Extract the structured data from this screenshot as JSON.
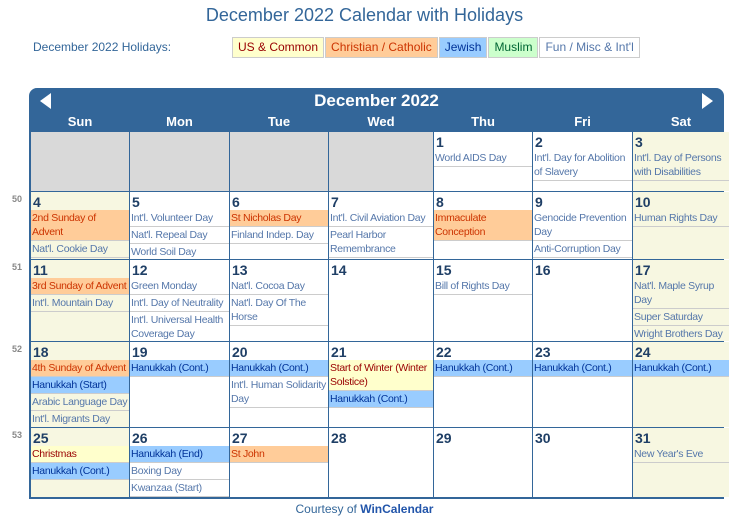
{
  "title": "December 2022 Calendar with Holidays",
  "legend_label": "December 2022 Holidays:",
  "legend": [
    {
      "label": "US & Common",
      "type": "us"
    },
    {
      "label": "Christian / Catholic",
      "type": "chr"
    },
    {
      "label": "Jewish",
      "type": "jew"
    },
    {
      "label": "Muslim",
      "type": "mus"
    },
    {
      "label": "Fun / Misc & Int'l",
      "type": "fun"
    }
  ],
  "colors": {
    "header": "#336699",
    "us": "#ffffcc",
    "christian": "#ffcc99",
    "jewish": "#99ccff",
    "muslim": "#ccffcc",
    "weekend": "#f7f7e1",
    "empty": "#d9d9d9"
  },
  "month": "December 2022",
  "nav": {
    "prev": "left-arrow-icon",
    "next": "right-arrow-icon"
  },
  "weekdays": [
    "Sun",
    "Mon",
    "Tue",
    "Wed",
    "Thu",
    "Fri",
    "Sat"
  ],
  "weeks": [
    {
      "num": "",
      "days": [
        null,
        null,
        null,
        null,
        {
          "d": "1",
          "ev": [
            {
              "t": "World AIDS Day",
              "c": "fun"
            }
          ]
        },
        {
          "d": "2",
          "ev": [
            {
              "t": "Int'l. Day for Abolition of Slavery",
              "c": "fun"
            }
          ]
        },
        {
          "d": "3",
          "ev": [
            {
              "t": "Int'l. Day of Persons with Disabilities",
              "c": "fun"
            }
          ]
        }
      ]
    },
    {
      "num": "50",
      "days": [
        {
          "d": "4",
          "ev": [
            {
              "t": "2nd Sunday of Advent",
              "c": "chr"
            },
            {
              "t": "Nat'l. Cookie Day",
              "c": "fun"
            }
          ]
        },
        {
          "d": "5",
          "ev": [
            {
              "t": "Int'l. Volunteer Day",
              "c": "fun"
            },
            {
              "t": "Nat'l. Repeal Day",
              "c": "fun"
            },
            {
              "t": "World Soil Day",
              "c": "fun"
            }
          ]
        },
        {
          "d": "6",
          "ev": [
            {
              "t": "St Nicholas Day",
              "c": "chr"
            },
            {
              "t": "Finland Indep. Day",
              "c": "fun"
            }
          ]
        },
        {
          "d": "7",
          "ev": [
            {
              "t": "Int'l. Civil Aviation Day",
              "c": "fun"
            },
            {
              "t": "Pearl Harbor Remembrance",
              "c": "fun"
            }
          ]
        },
        {
          "d": "8",
          "ev": [
            {
              "t": "Immaculate Conception",
              "c": "chr"
            }
          ]
        },
        {
          "d": "9",
          "ev": [
            {
              "t": "Genocide Prevention Day",
              "c": "fun"
            },
            {
              "t": "Anti-Corruption Day",
              "c": "fun"
            }
          ]
        },
        {
          "d": "10",
          "ev": [
            {
              "t": "Human Rights Day",
              "c": "fun"
            }
          ]
        }
      ]
    },
    {
      "num": "51",
      "days": [
        {
          "d": "11",
          "ev": [
            {
              "t": "3rd Sunday of Advent",
              "c": "chr"
            },
            {
              "t": "Int'l. Mountain Day",
              "c": "fun"
            }
          ]
        },
        {
          "d": "12",
          "ev": [
            {
              "t": "Green Monday",
              "c": "fun"
            },
            {
              "t": "Int'l. Day of Neutrality",
              "c": "fun"
            },
            {
              "t": "Int'l. Universal Health Coverage Day",
              "c": "fun"
            }
          ]
        },
        {
          "d": "13",
          "ev": [
            {
              "t": "Nat'l. Cocoa Day",
              "c": "fun"
            },
            {
              "t": "Nat'l. Day Of The Horse",
              "c": "fun"
            }
          ]
        },
        {
          "d": "14",
          "ev": []
        },
        {
          "d": "15",
          "ev": [
            {
              "t": "Bill of Rights Day",
              "c": "fun"
            }
          ]
        },
        {
          "d": "16",
          "ev": []
        },
        {
          "d": "17",
          "ev": [
            {
              "t": "Nat'l. Maple Syrup Day",
              "c": "fun"
            },
            {
              "t": "Super Saturday",
              "c": "fun"
            },
            {
              "t": "Wright Brothers Day",
              "c": "fun"
            }
          ]
        }
      ]
    },
    {
      "num": "52",
      "days": [
        {
          "d": "18",
          "ev": [
            {
              "t": "4th Sunday of Advent",
              "c": "chr"
            },
            {
              "t": "Hanukkah (Start)",
              "c": "jew"
            },
            {
              "t": "Arabic Language Day",
              "c": "fun"
            },
            {
              "t": "Int'l. Migrants Day",
              "c": "fun"
            }
          ]
        },
        {
          "d": "19",
          "ev": [
            {
              "t": "Hanukkah (Cont.)",
              "c": "jew"
            }
          ]
        },
        {
          "d": "20",
          "ev": [
            {
              "t": "Hanukkah (Cont.)",
              "c": "jew"
            },
            {
              "t": "Int'l. Human Solidarity Day",
              "c": "fun"
            }
          ]
        },
        {
          "d": "21",
          "ev": [
            {
              "t": "Start of Winter (Winter Solstice)",
              "c": "us"
            },
            {
              "t": "Hanukkah (Cont.)",
              "c": "jew"
            }
          ]
        },
        {
          "d": "22",
          "ev": [
            {
              "t": "Hanukkah (Cont.)",
              "c": "jew"
            }
          ]
        },
        {
          "d": "23",
          "ev": [
            {
              "t": "Hanukkah (Cont.)",
              "c": "jew"
            }
          ]
        },
        {
          "d": "24",
          "ev": [
            {
              "t": "Hanukkah (Cont.)",
              "c": "jew"
            }
          ]
        }
      ]
    },
    {
      "num": "53",
      "days": [
        {
          "d": "25",
          "ev": [
            {
              "t": "Christmas",
              "c": "us"
            },
            {
              "t": "Hanukkah (Cont.)",
              "c": "jew"
            }
          ]
        },
        {
          "d": "26",
          "ev": [
            {
              "t": "Hanukkah (End)",
              "c": "jew"
            },
            {
              "t": "Boxing Day",
              "c": "fun"
            },
            {
              "t": "Kwanzaa (Start)",
              "c": "fun"
            }
          ]
        },
        {
          "d": "27",
          "ev": [
            {
              "t": "St John",
              "c": "chr"
            }
          ]
        },
        {
          "d": "28",
          "ev": []
        },
        {
          "d": "29",
          "ev": []
        },
        {
          "d": "30",
          "ev": []
        },
        {
          "d": "31",
          "ev": [
            {
              "t": "New Year's Eve",
              "c": "fun"
            }
          ]
        }
      ]
    }
  ],
  "footer": {
    "prefix": "Courtesy of",
    "link": "WinCalendar"
  }
}
